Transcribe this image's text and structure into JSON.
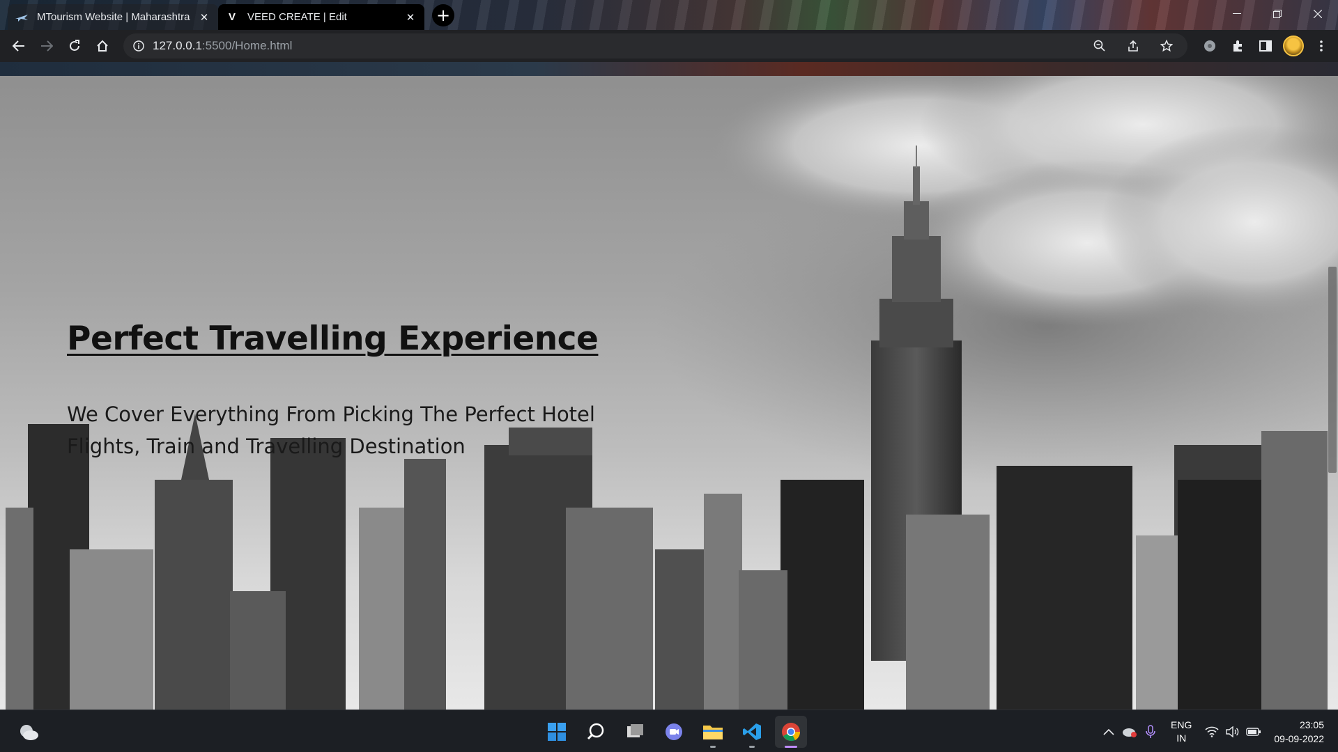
{
  "browser": {
    "tabs": [
      {
        "title": "MTourism Website | Maharashtra",
        "favicon": "plane-icon",
        "active": false
      },
      {
        "title": "VEED CREATE | Edit",
        "favicon": "V",
        "active": true
      }
    ],
    "new_tab_label": "+",
    "url": {
      "host": "127.0.0.1",
      "path": ":5500/Home.html"
    }
  },
  "hero": {
    "title": "Perfect Travelling Experience",
    "subtitle_line1": "We Cover Everything From Picking The Perfect Hotel",
    "subtitle_line2": "Flights, Train and Travelling Destination"
  },
  "taskbar": {
    "lang_top": "ENG",
    "lang_bottom": "IN",
    "time": "23:05",
    "date": "09-09-2022",
    "apps": [
      "start-icon",
      "search-icon",
      "task-view-icon",
      "teams-chat-icon",
      "file-explorer-icon",
      "vscode-icon",
      "chrome-icon"
    ]
  },
  "colors": {
    "chrome_dark": "#202124",
    "text_dark": "#111111",
    "accent_purple": "#c08cff"
  }
}
